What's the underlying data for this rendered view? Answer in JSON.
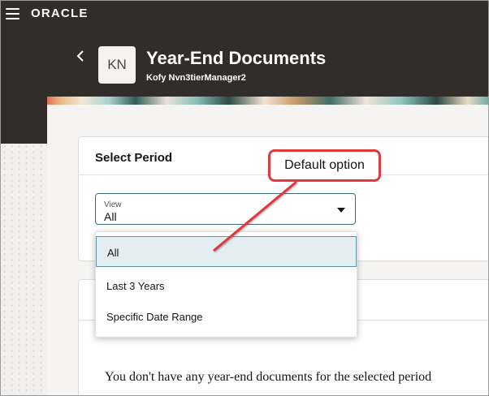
{
  "header": {
    "logo": "ORACLE",
    "title": "Year-End Documents",
    "subtitle": "Kofy Nvn3tierManager2",
    "avatar_initials": "KN"
  },
  "select_period": {
    "title": "Select Period",
    "field_label": "View",
    "field_value": "All",
    "options": [
      "All",
      "Last 3 Years",
      "Specific Date Range"
    ],
    "selected_option": "All"
  },
  "empty_message": "You don't have any year-end documents for the selected period",
  "annotation": {
    "text": "Default option",
    "color": "#e0393e"
  },
  "colors": {
    "header_bg": "#312d2a",
    "select_border": "#3b6e79",
    "selected_item_bg": "#e3edf2"
  }
}
